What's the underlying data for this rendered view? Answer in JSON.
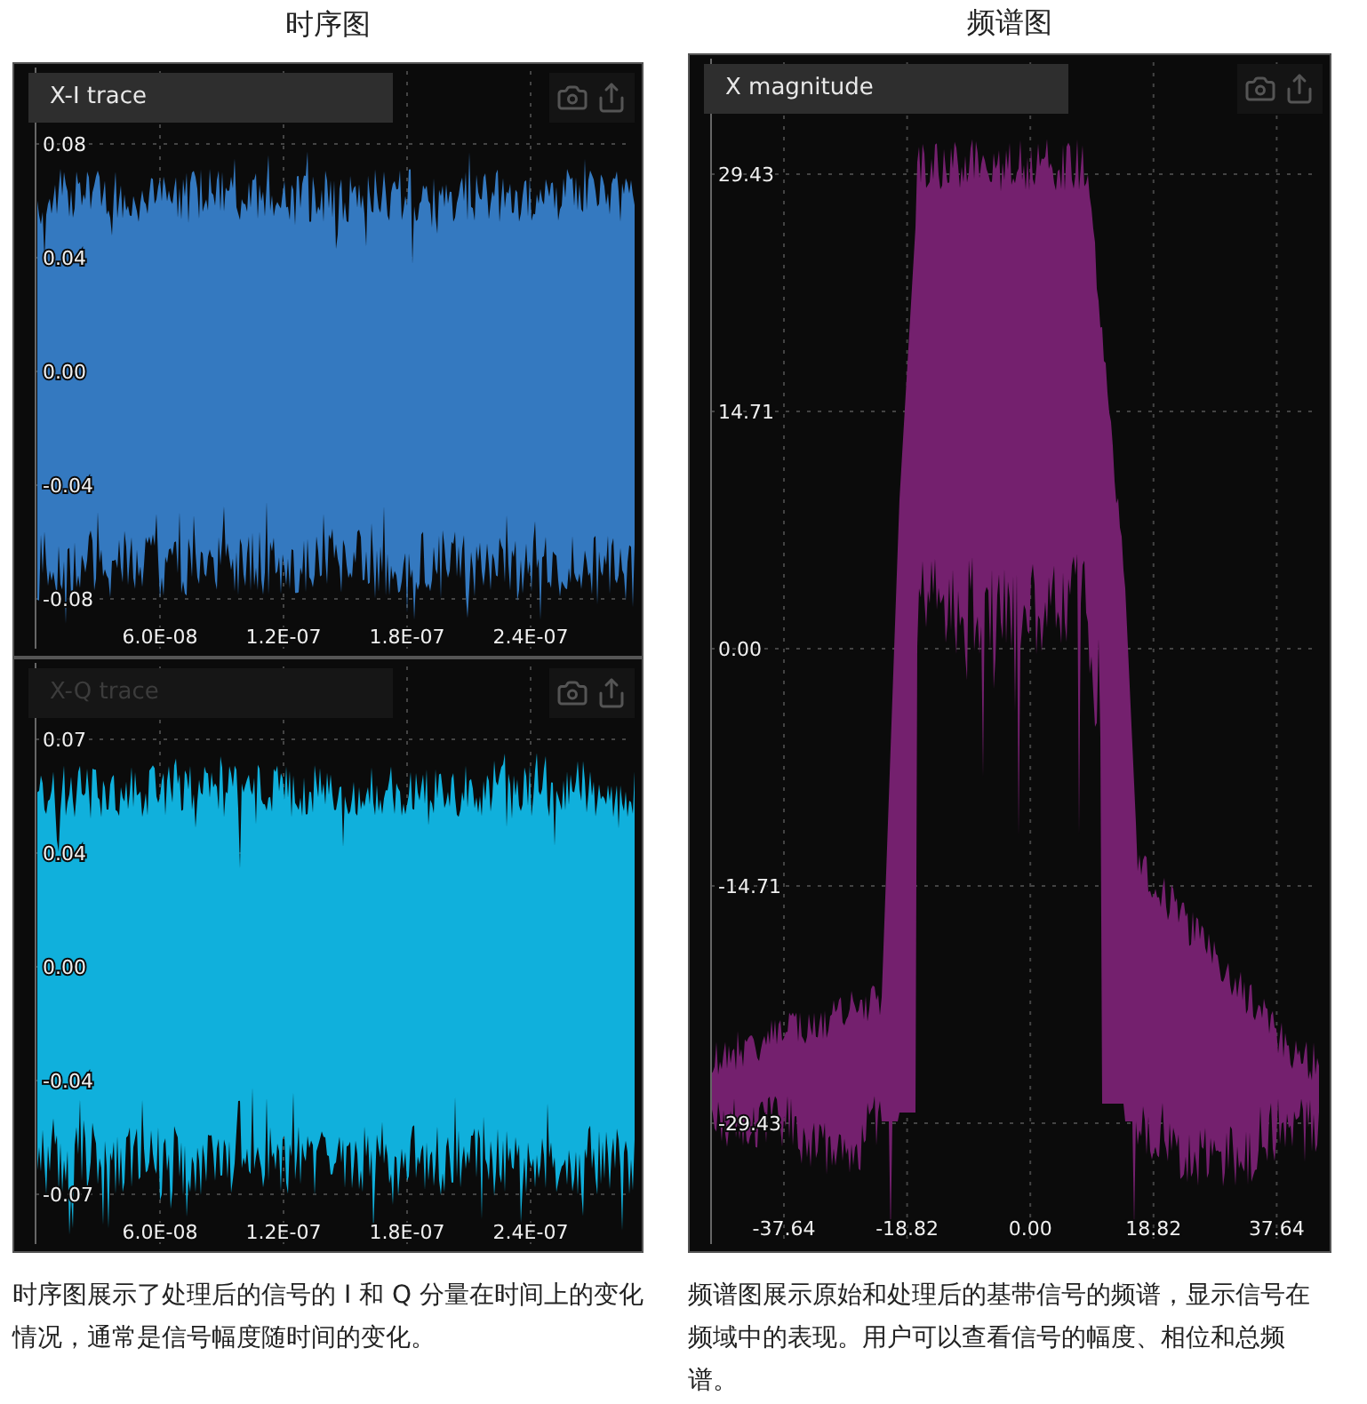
{
  "time_domain": {
    "heading": "时序图",
    "plots": [
      {
        "title": "X-I trace",
        "title_faded": false,
        "color": "#3479c0",
        "yticks": [
          "0.08",
          "0.04",
          "0.00",
          "-0.04",
          "-0.08"
        ],
        "xticks": [
          "6.0E-08",
          "1.2E-07",
          "1.8E-07",
          "2.4E-07"
        ]
      },
      {
        "title": "X-Q trace",
        "title_faded": true,
        "color": "#10b0dc",
        "yticks": [
          "0.07",
          "0.04",
          "0.00",
          "-0.04",
          "-0.07"
        ],
        "xticks": [
          "6.0E-08",
          "1.2E-07",
          "1.8E-07",
          "2.4E-07"
        ]
      }
    ],
    "caption": "时序图展示了处理后的信号的 I 和 Q 分量在时间上的变化情况，通常是信号幅度随时间的变化。"
  },
  "spectrum": {
    "heading": "频谱图",
    "plot": {
      "title": "X magnitude",
      "title_faded": false,
      "color": "#74206e",
      "yticks": [
        "29.43",
        "14.71",
        "0.00",
        "-14.71",
        "-29.43"
      ],
      "xticks": [
        "-37.64",
        "-18.82",
        "0.00",
        "18.82",
        "37.64"
      ]
    },
    "caption": "频谱图展示原始和处理后的基带信号的频谱，显示信号在频域中的表现。用户可以查看信号的幅度、相位和总频谱。"
  }
}
